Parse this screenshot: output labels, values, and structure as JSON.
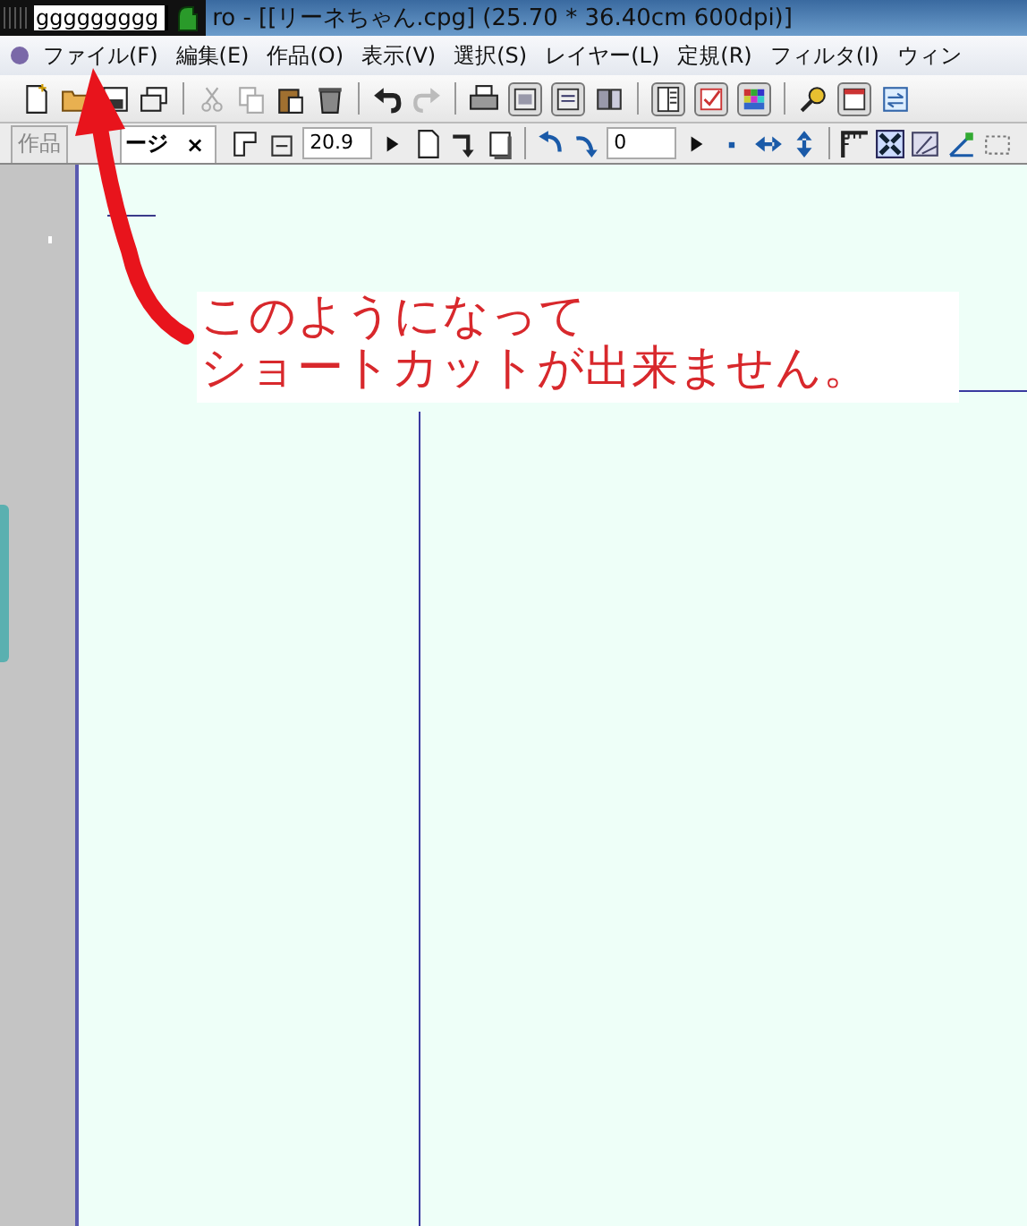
{
  "title_bar": {
    "ime_input": "ggggggggg",
    "title": "ro - [[リーネちゃん.cpg] (25.70 * 36.40cm 600dpi)]"
  },
  "menu": [
    {
      "label": "ファイル(F)"
    },
    {
      "label": "編集(E)"
    },
    {
      "label": "作品(O)"
    },
    {
      "label": "表示(V)"
    },
    {
      "label": "選択(S)"
    },
    {
      "label": "レイヤー(L)"
    },
    {
      "label": "定規(R)"
    },
    {
      "label": "フィルタ(I)"
    },
    {
      "label": "ウィン"
    }
  ],
  "tabs": [
    {
      "label": "作品",
      "selected": false
    },
    {
      "label": "ージ",
      "selected": true,
      "close": "×"
    }
  ],
  "zoom_value": "20.9",
  "rotation_value": "0",
  "annotation": {
    "lines": [
      "このようになって",
      "ショートカットが出来ません。"
    ]
  }
}
